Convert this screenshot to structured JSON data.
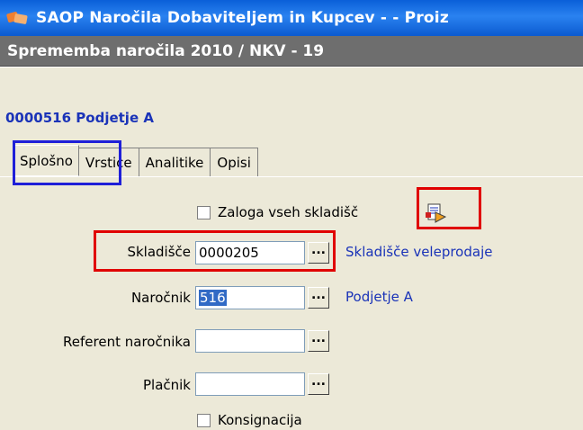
{
  "window": {
    "title": "SAOP   Naročila Dobaviteljem in Kupcev -  - Proiz"
  },
  "header": {
    "title": "Sprememba naročila 2010 / NKV - 19"
  },
  "company": {
    "label": "0000516 Podjetje A"
  },
  "tabs": [
    {
      "label": "Splošno",
      "active": true
    },
    {
      "label": "Vrstice",
      "active": false
    },
    {
      "label": "Analitike",
      "active": false
    },
    {
      "label": "Opisi",
      "active": false
    }
  ],
  "form": {
    "zaloga_checkbox": {
      "label": "Zaloga vseh skladišč",
      "checked": false
    },
    "skladisce": {
      "label": "Skladišče",
      "value": "0000205",
      "lookup": "Skladišče veleprodaje",
      "button": "..."
    },
    "narocnik": {
      "label": "Naročnik",
      "value": "516",
      "lookup": "Podjetje A",
      "button": "..."
    },
    "referent": {
      "label": "Referent naročnika",
      "value": "",
      "button": "..."
    },
    "placnik": {
      "label": "Plačnik",
      "value": "",
      "button": "..."
    },
    "konsignacija_checkbox": {
      "label": "Konsignacija",
      "checked": false
    }
  },
  "colors": {
    "titlebar": "#0a5fd8",
    "header": "#6e6e6e",
    "link": "#1a33b8",
    "highlight_red": "#e00000",
    "highlight_blue": "#1f1fd8"
  }
}
